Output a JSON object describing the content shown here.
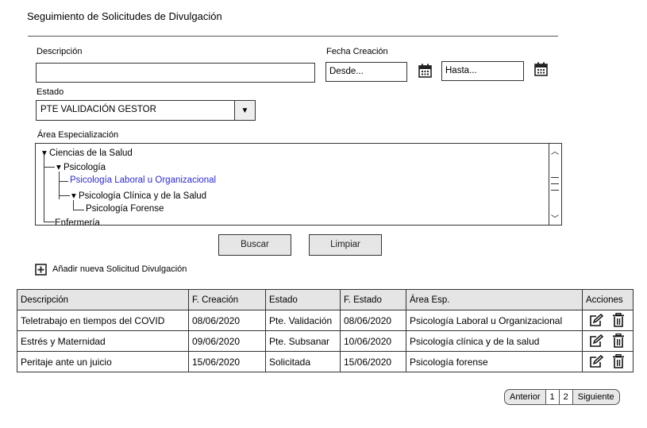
{
  "page": {
    "title": "Seguimiento de Solicitudes de Divulgación"
  },
  "filters": {
    "descripcion_label": "Descripción",
    "descripcion_value": "",
    "fecha_creacion_label": "Fecha Creación",
    "desde_placeholder": "Desde...",
    "hasta_placeholder": "Hasta...",
    "estado_label": "Estado",
    "estado_value": "PTE VALIDACIÓN GESTOR",
    "area_label": "Área Especialización"
  },
  "tree": {
    "items": [
      {
        "label": "Ciencias de la Salud",
        "expanded": true,
        "level": 0
      },
      {
        "label": "Psicología",
        "expanded": true,
        "level": 1
      },
      {
        "label": "Psicología Laboral u Organizacional",
        "selected": true,
        "level": 2
      },
      {
        "label": "Psicología Clínica y de la Salud",
        "expanded": true,
        "level": 2
      },
      {
        "label": "Psicología Forense",
        "level": 3
      },
      {
        "label": "Enfermería",
        "level": 1
      }
    ]
  },
  "actions": {
    "buscar": "Buscar",
    "limpiar": "Limpiar",
    "add_label": "Añadir nueva Solicitud Divulgación"
  },
  "table": {
    "headers": [
      "Descripción",
      "F. Creación",
      "Estado",
      "F. Estado",
      "Área Esp.",
      "Acciones"
    ],
    "rows": [
      [
        "Teletrabajo en tiempos del COVID",
        "08/06/2020",
        "Pte. Validación",
        "08/06/2020",
        "Psicología Laboral u Organizacional"
      ],
      [
        "Estrés y Maternidad",
        "09/06/2020",
        "Pte. Subsanar",
        "10/06/2020",
        "Psicología clínica y de la salud"
      ],
      [
        "Peritaje ante un juicio",
        "15/06/2020",
        "Solicitada",
        "15/06/2020",
        "Psicología forense"
      ]
    ]
  },
  "pager": {
    "prev": "Anterior",
    "pages": [
      "1",
      "2"
    ],
    "next": "Siguiente"
  },
  "icons": {
    "calendar": "calendar-icon",
    "edit": "edit-icon",
    "delete": "trash-icon",
    "add": "plus-box-icon",
    "dropdown": "triangle-down-icon"
  }
}
